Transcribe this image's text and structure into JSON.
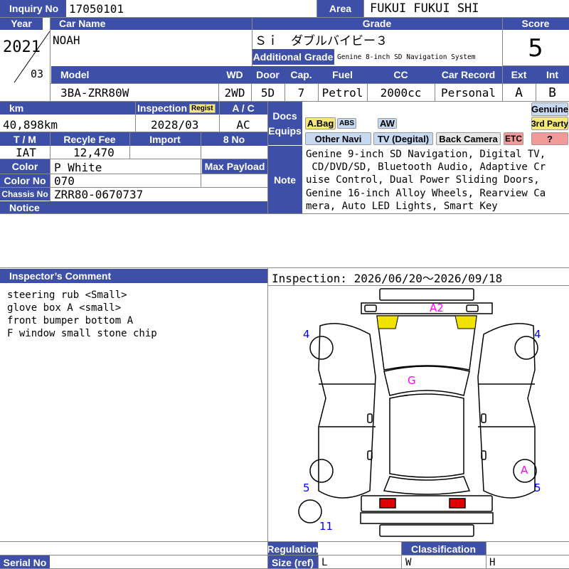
{
  "header": {
    "inquiry_label": "Inquiry No",
    "inquiry_no": "17050101",
    "area_label": "Area",
    "area": "FUKUI FUKUI SHI",
    "year_label": "Year",
    "year": "2021",
    "month": "03",
    "car_name_label": "Car Name",
    "car_name": "NOAH",
    "grade_label": "Grade",
    "grade": "Ｓｉ　ダブルバイビー３",
    "add_grade_label": "Additional Grade",
    "add_grade": "Genine 8-inch SD Navigation System",
    "score_label": "Score",
    "score": "5"
  },
  "specs": {
    "model_label": "Model",
    "model": "3BA-ZRR80W",
    "wd_label": "WD",
    "wd": "2WD",
    "door_label": "Door",
    "door": "5D",
    "cap_label": "Cap.",
    "cap": "7",
    "fuel_label": "Fuel",
    "fuel": "Petrol",
    "cc_label": "CC",
    "cc": "2000cc",
    "record_label": "Car Record",
    "record": "Personal",
    "ext_label": "Ext",
    "ext": "A",
    "int_label": "Int",
    "int": "B"
  },
  "details": {
    "km_label": "km",
    "km": "40,898km",
    "inspection_label": "Inspection",
    "regist_badge": "Regist",
    "inspection": "2028/03",
    "ac_label": "A / C",
    "ac": "AC",
    "tm_label": "T / M",
    "tm": "IAT",
    "recycle_label": "Recyle Fee",
    "recycle": "12,470",
    "import_label": "Import",
    "import": "",
    "eightno_label": "8 No",
    "eightno": "",
    "color_label": "Color",
    "color": "P White",
    "payload_label": "Max Payload",
    "payload": "",
    "colorno_label": "Color No",
    "colorno": "070",
    "chassis_label": "Chassis No",
    "chassis": "ZRR80-0670737",
    "notice_label": "Notice",
    "notice": ""
  },
  "equips": {
    "docs_label": "Docs\nEquips",
    "tags": [
      "A.Bag",
      "ABS",
      "AW",
      "Other Navi",
      "TV (Degital)",
      "Back Camera",
      "ETC"
    ],
    "genuine": "Genuine",
    "third_party": "3rd Party",
    "question": "?"
  },
  "note": {
    "label": "Note",
    "lines": [
      "Genine 9-inch SD Navigation, Digital TV,",
      " CD/DVD/SD, Bluetooth Audio, Adaptive Cr",
      "uise Control, Dual Power Sliding Doors,",
      "Genine 16-inch Alloy Wheels, Rearview Ca",
      "mera, Auto LED Lights, Smart Key"
    ]
  },
  "comment": {
    "label": "Inspector’s Comment",
    "lines": [
      "steering rub <Small>",
      "glove box A <small>",
      "front bumper bottom A",
      "F window small stone chip"
    ]
  },
  "inspection_period": "Inspection: 2026/06/20〜2026/09/18",
  "diagram_marks": {
    "front": "A2",
    "glass": "G",
    "fl_tire": "4",
    "fr_tire": "4",
    "rl_tire": "5",
    "rr_tire": "5",
    "rr_wheel": "A",
    "spare": "11"
  },
  "footer": {
    "regulation_label": "Regulation",
    "classification_label": "Classification",
    "size_label": "Size (ref)",
    "size_l": "L",
    "size_w": "W",
    "size_h": "H",
    "serial_label": "Serial No",
    "serial": ""
  },
  "colors": {
    "header_bg": "#3d4fa6",
    "mark_pink": "#ff00ff",
    "mark_blue": "#0000ff"
  }
}
